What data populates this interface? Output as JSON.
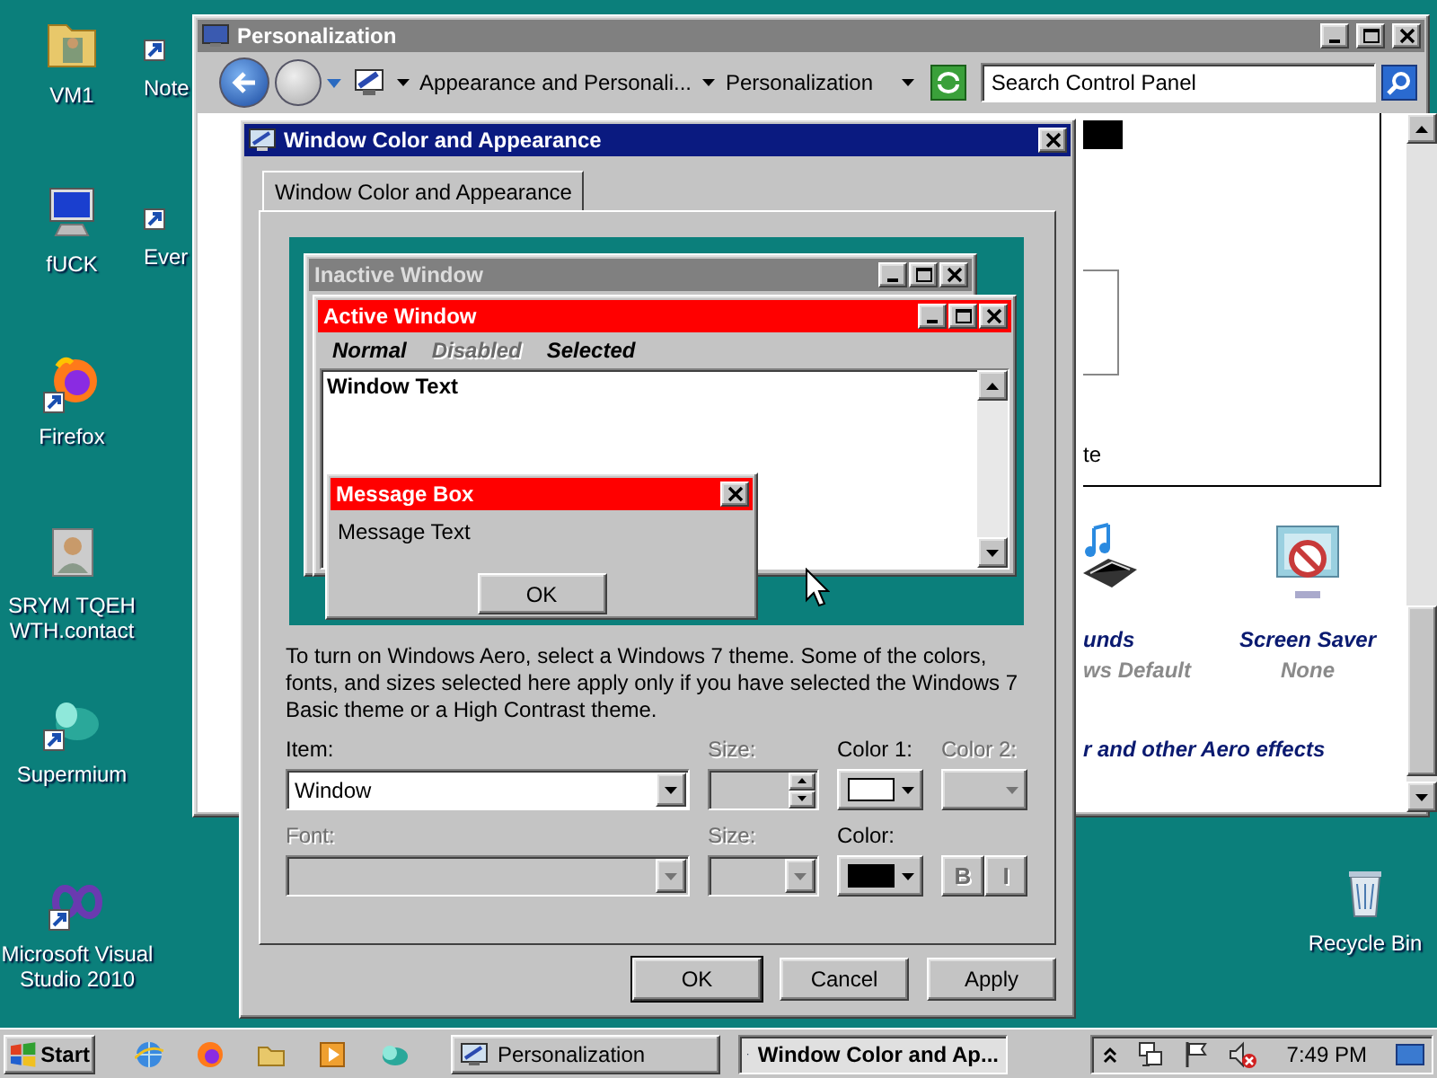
{
  "desktop": {
    "icons": [
      {
        "label": "VM1"
      },
      {
        "label": "Note"
      },
      {
        "label": "fUCK"
      },
      {
        "label": "Ever"
      },
      {
        "label": "Firefox"
      },
      {
        "label": "SRYM TQEH WTH.contact"
      },
      {
        "label": "Supermium"
      },
      {
        "label": "Microsoft Visual Studio 2010"
      },
      {
        "label": "Recycle Bin"
      }
    ]
  },
  "personalization_window": {
    "title": "Personalization",
    "breadcrumb": [
      {
        "label": "Appearance and Personali..."
      },
      {
        "label": "Personalization"
      }
    ],
    "search": {
      "placeholder": "Search Control Panel"
    },
    "preview_text": "te",
    "items": [
      {
        "title": "unds",
        "subtitle": "ws Default"
      },
      {
        "title": "Screen Saver",
        "subtitle": "None"
      }
    ],
    "link": "r and other Aero effects"
  },
  "dialog": {
    "title": "Window Color and Appearance",
    "tabs": [
      {
        "label": "Window Color and Appearance",
        "selected": true
      }
    ],
    "preview": {
      "inactive_title": "Inactive Window",
      "active_title": "Active Window",
      "menu": [
        {
          "label": "Normal",
          "kind": "normal"
        },
        {
          "label": "Disabled",
          "kind": "disabled"
        },
        {
          "label": "Selected",
          "kind": "selected"
        }
      ],
      "window_text": "Window Text",
      "message_box": {
        "title": "Message Box",
        "text": "Message Text",
        "button": "OK"
      }
    },
    "note": "To turn on Windows Aero, select a Windows 7 theme.  Some of the colors, fonts, and sizes selected here apply only if you have selected the Windows 7 Basic theme or a High Contrast theme.",
    "rows": [
      [
        {
          "kind": "dropdown",
          "label": "Item:",
          "value": "Window",
          "disabled": false
        },
        {
          "kind": "spinner",
          "label": "Size:",
          "disabled": true
        },
        {
          "kind": "color",
          "label": "Color 1:",
          "color": "#ffffff",
          "disabled": false
        },
        {
          "kind": "color",
          "label": "Color 2:",
          "disabled": true
        }
      ],
      [
        {
          "kind": "dropdown",
          "label": "Font:",
          "disabled": true
        },
        {
          "kind": "dropdown",
          "label": "Size:",
          "disabled": true
        },
        {
          "kind": "color",
          "label": "Color:",
          "color": "#000000",
          "disabled": false
        },
        {
          "kind": "style",
          "buttons": [
            "B",
            "I"
          ],
          "disabled": true
        }
      ]
    ],
    "buttons": [
      {
        "label": "OK",
        "default": true
      },
      {
        "label": "Cancel",
        "default": false
      },
      {
        "label": "Apply",
        "default": false
      }
    ]
  },
  "taskbar": {
    "start": "Start",
    "tasks": [
      {
        "label": "Personalization",
        "selected": false
      },
      {
        "label": "Window Color and Ap...",
        "selected": true
      }
    ],
    "clock": "7:49 PM"
  }
}
